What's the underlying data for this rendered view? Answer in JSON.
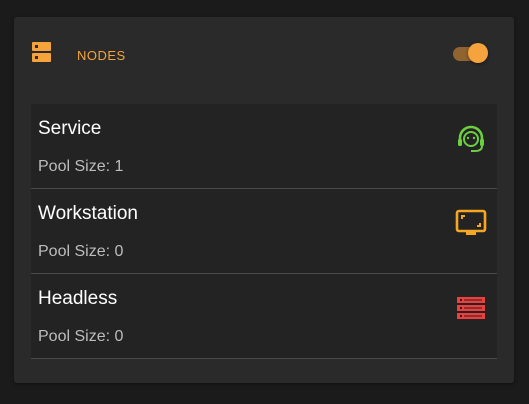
{
  "card": {
    "title": "NODES",
    "header_icon": "dns-icon",
    "toggle": {
      "checked": true,
      "color": "#f7a33d"
    }
  },
  "nodes": [
    {
      "name": "Service",
      "pool_label": "Pool Size: 1",
      "icon": "support-agent-icon",
      "icon_color": "#6ccf3f"
    },
    {
      "name": "Workstation",
      "pool_label": "Pool Size: 0",
      "icon": "monitor-icon",
      "icon_color": "#f5a623"
    },
    {
      "name": "Headless",
      "pool_label": "Pool Size: 0",
      "icon": "server-rack-icon",
      "icon_color": "#ee3e3e"
    }
  ]
}
